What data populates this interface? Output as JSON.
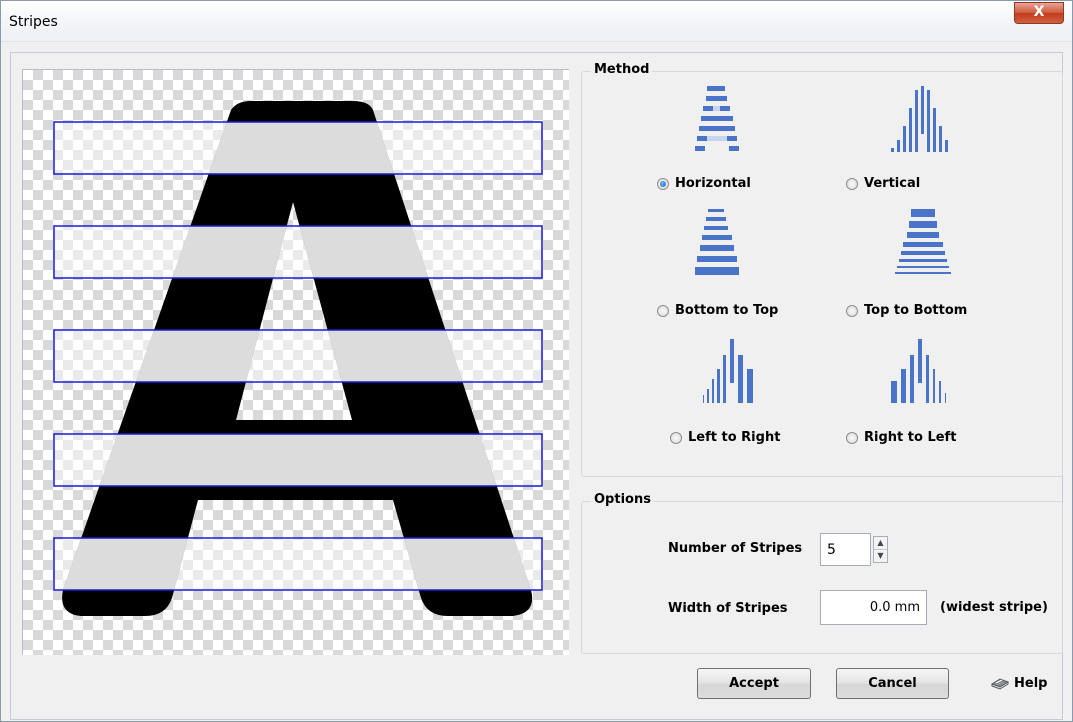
{
  "window": {
    "title": "Stripes",
    "close_label": "X"
  },
  "preview": {
    "letter": "A",
    "stripe_count": 5
  },
  "method": {
    "legend": "Method",
    "options": [
      {
        "label": "Horizontal",
        "icon": "horizontal-stripes-icon",
        "selected": true
      },
      {
        "label": "Vertical",
        "icon": "vertical-stripes-icon",
        "selected": false
      },
      {
        "label": "Bottom to Top",
        "icon": "bottom-to-top-stripes-icon",
        "selected": false
      },
      {
        "label": "Top to Bottom",
        "icon": "top-to-bottom-stripes-icon",
        "selected": false
      },
      {
        "label": "Left to Right",
        "icon": "left-to-right-stripes-icon",
        "selected": false
      },
      {
        "label": "Right to Left",
        "icon": "right-to-left-stripes-icon",
        "selected": false
      }
    ]
  },
  "options": {
    "legend": "Options",
    "num_stripes_label": "Number of Stripes",
    "num_stripes_value": "5",
    "width_label": "Width of Stripes",
    "width_value": "0.0 mm",
    "width_note": "(widest stripe)"
  },
  "buttons": {
    "accept": "Accept",
    "cancel": "Cancel",
    "help": "Help"
  },
  "colors": {
    "stripe_outline": "#1a1adb",
    "letter": "#000000",
    "letter_stripe": "#c0c0c0",
    "icon_blue": "#4a74c9"
  }
}
